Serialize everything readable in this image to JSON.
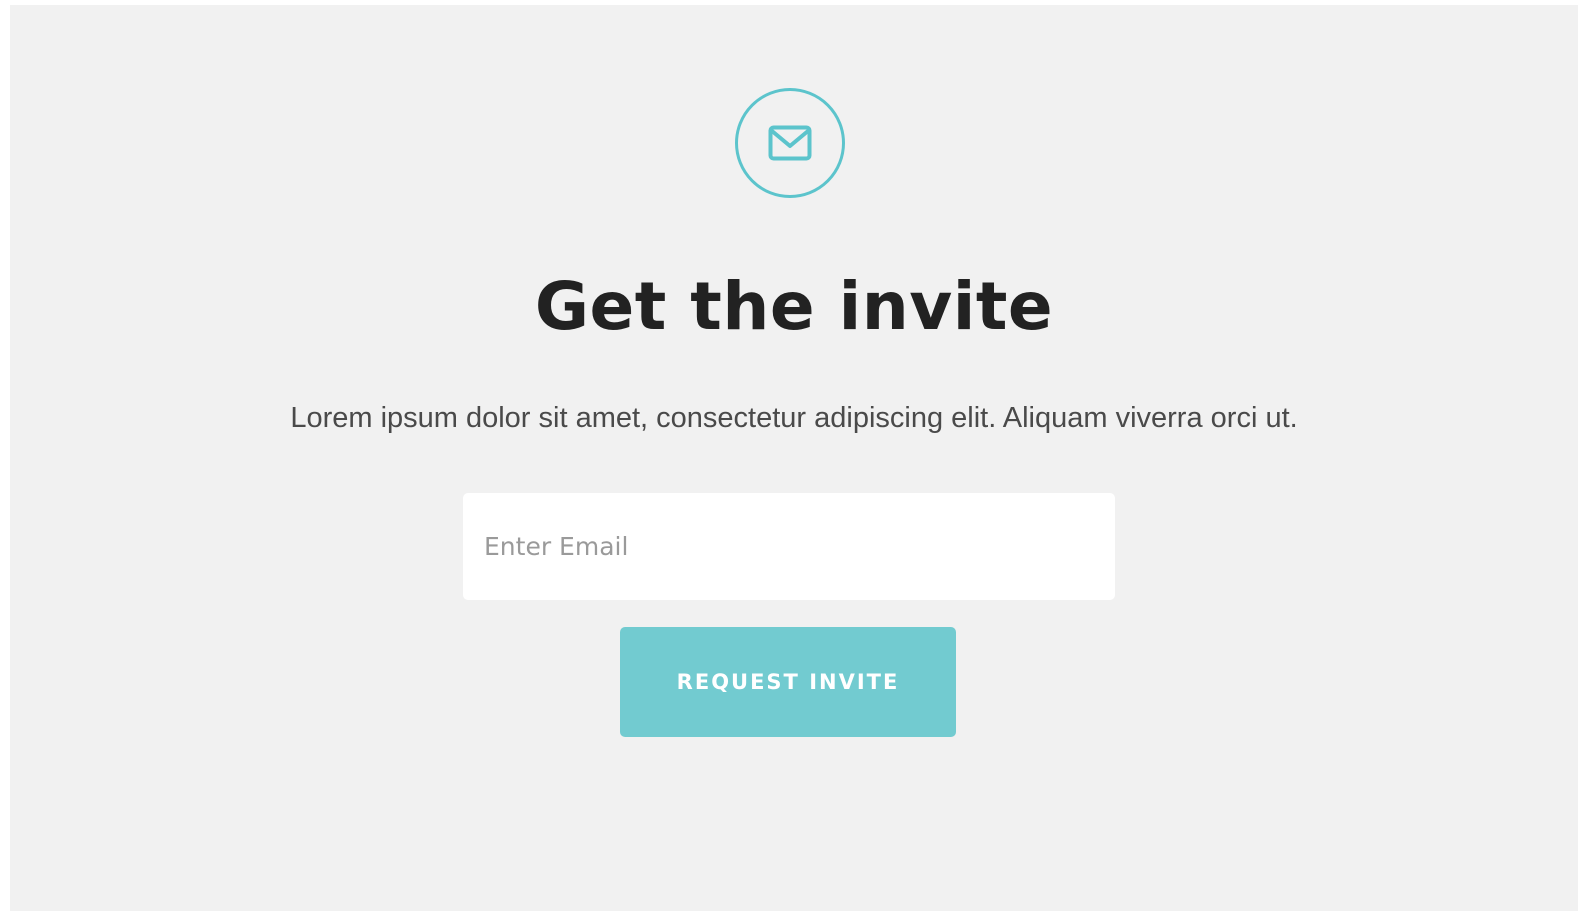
{
  "icon": {
    "name": "envelope-icon",
    "color": "#5cc4cc"
  },
  "heading": {
    "title": "Get the invite",
    "description": "Lorem ipsum dolor sit amet, consectetur adipiscing elit. Aliquam viverra orci ut."
  },
  "form": {
    "email_placeholder": "Enter Email",
    "email_value": "",
    "submit_label": "REQUEST INVITE",
    "button_color": "#72cbd0"
  },
  "colors": {
    "background": "#f1f1f1",
    "accent": "#5cc4cc",
    "title": "#222222",
    "text": "#4a4a4a"
  }
}
